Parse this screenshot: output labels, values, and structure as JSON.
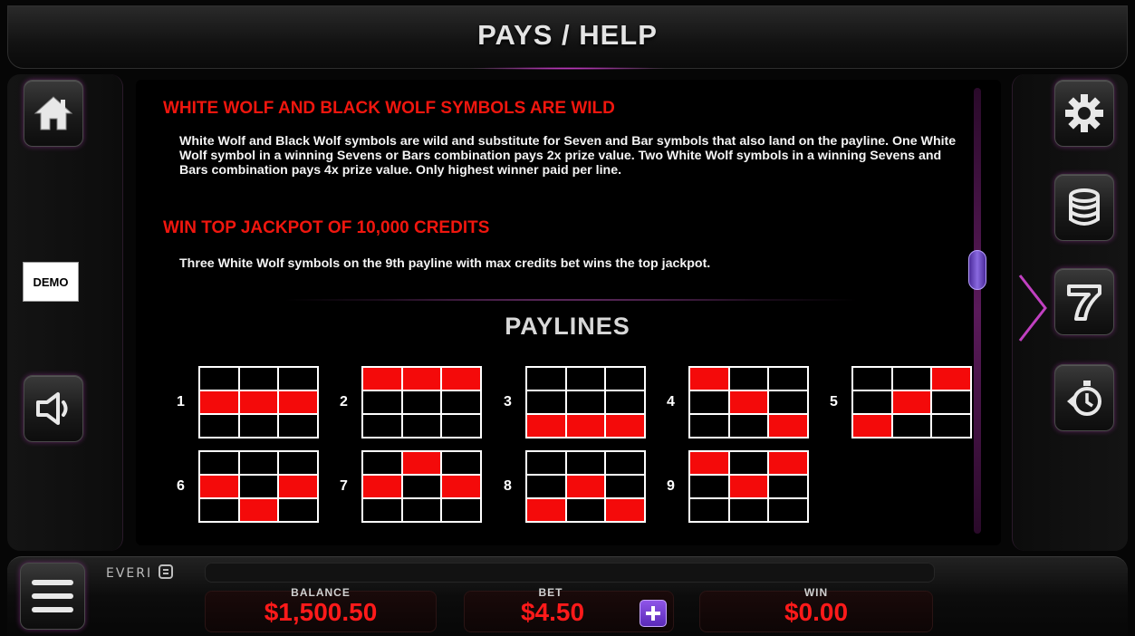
{
  "header": {
    "title": "PAYS / HELP"
  },
  "left_nav": {
    "home_icon": "home-icon",
    "demo_badge": "DEMO",
    "sound_icon": "speaker-icon"
  },
  "right_nav": {
    "settings_icon": "gear-icon",
    "bet_icon": "coin-stack-icon",
    "paytable_icon": "seven-icon",
    "history_icon": "timer-back-icon"
  },
  "help": {
    "section1_heading": "WHITE WOLF AND BLACK WOLF SYMBOLS ARE WILD",
    "section1_body": "White Wolf and Black Wolf symbols are wild and substitute for Seven and Bar symbols that also land on the payline. One White Wolf symbol in a winning Sevens or Bars combination pays 2x prize value. Two White Wolf symbols in a winning Sevens and Bars combination pays 4x prize value. Only highest winner paid per line.",
    "section2_heading": "WIN TOP JACKPOT OF 10,000 CREDITS",
    "section2_body": "Three White Wolf symbols on the 9th payline with max credits bet wins the top jackpot.",
    "paylines_title": "PAYLINES",
    "paylines": [
      {
        "label": "1",
        "rows": [
          1,
          1,
          1
        ]
      },
      {
        "label": "2",
        "rows": [
          0,
          0,
          0
        ]
      },
      {
        "label": "3",
        "rows": [
          2,
          2,
          2
        ]
      },
      {
        "label": "4",
        "rows": [
          0,
          1,
          2
        ]
      },
      {
        "label": "5",
        "rows": [
          2,
          1,
          0
        ]
      },
      {
        "label": "6",
        "rows": [
          1,
          2,
          1
        ]
      },
      {
        "label": "7",
        "rows": [
          1,
          0,
          1
        ]
      },
      {
        "label": "8",
        "rows": [
          2,
          1,
          2
        ]
      },
      {
        "label": "9",
        "rows": [
          0,
          1,
          0
        ]
      }
    ]
  },
  "footer": {
    "brand": "EVERI",
    "balance_label": "BALANCE",
    "balance_value": "$1,500.50",
    "bet_label": "BET",
    "bet_value": "$4.50",
    "win_label": "WIN",
    "win_value": "$0.00"
  },
  "colors": {
    "accent_red": "#f0160e",
    "accent_purple": "#8a5ae0",
    "payline_red": "#f40a0a"
  }
}
